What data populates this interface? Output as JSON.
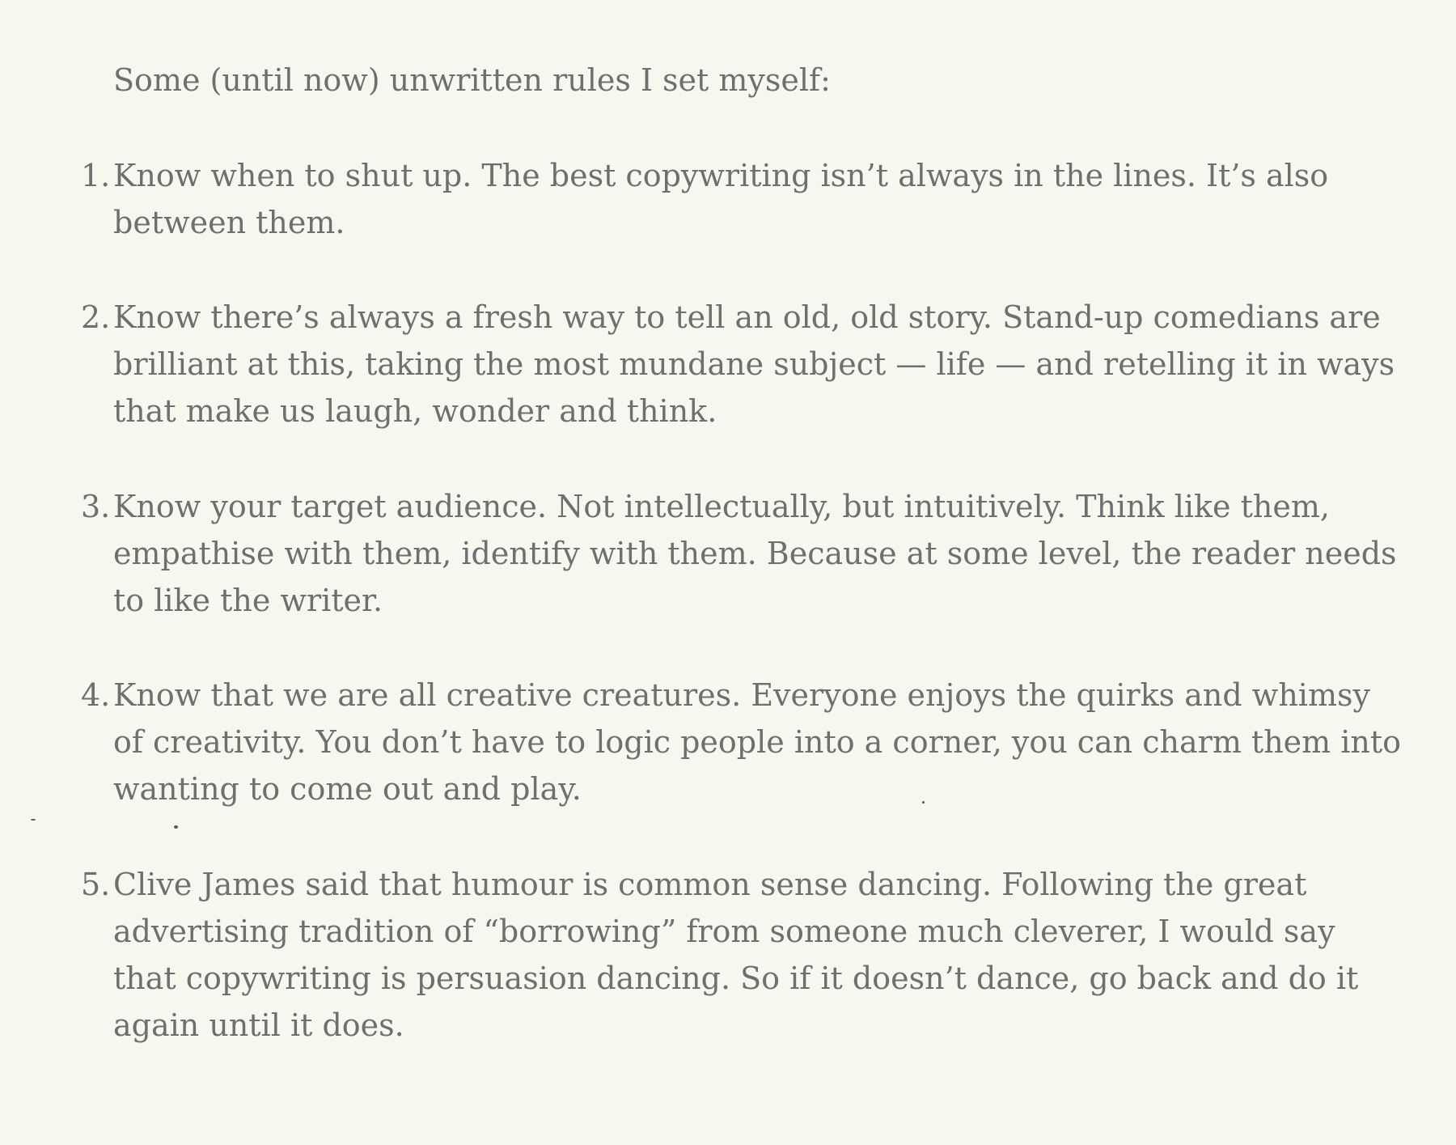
{
  "intro": "Some (until now) unwritten rules I set myself:",
  "rules": [
    {
      "number": "1.",
      "text": "Know when to shut up. The best copywriting isn’t always in the lines. It’s also between them."
    },
    {
      "number": "2.",
      "text": "Know there’s always a fresh way to tell an old, old story. Stand-up comedians are brilliant at this, taking the most mundane subject — life — and retelling it in ways that make us laugh, wonder and think."
    },
    {
      "number": "3.",
      "text": "Know your target audience. Not intellectually, but intuitively. Think like them, empathise with them, identify with them. Because at some level, the reader needs to like the writer."
    },
    {
      "number": "4.",
      "text": "Know that we are all creative creatures. Everyone enjoys the quirks and whimsy of creativity. You don’t have to logic people into a corner, you can charm them into wanting to come out and play."
    },
    {
      "number": "5.",
      "text": "Clive James said that humour is common sense dancing. Following the great advertising tradition of “borrowing” from someone much cleverer, I would say that copywriting is persuasion dancing. So if it doesn’t dance, go back and do it again until it does."
    }
  ]
}
